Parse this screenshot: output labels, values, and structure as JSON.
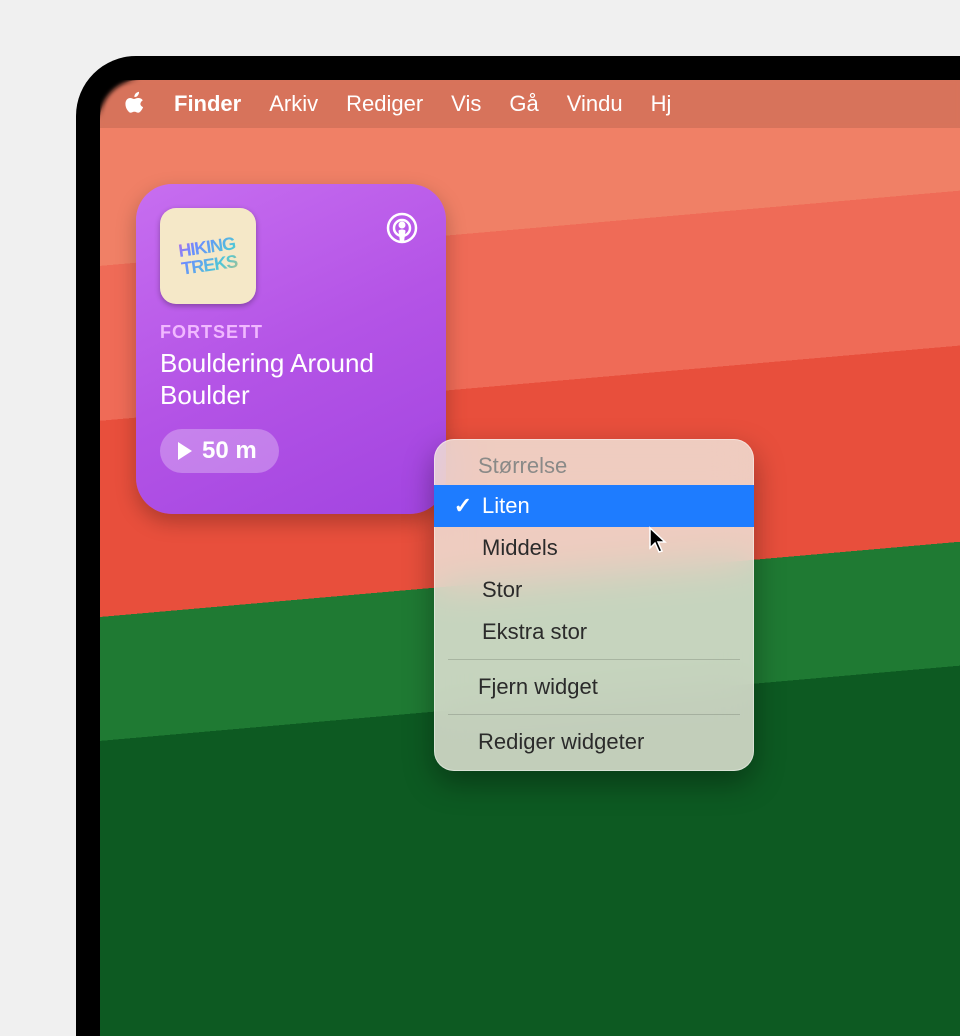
{
  "menubar": {
    "app_name": "Finder",
    "items": [
      "Arkiv",
      "Rediger",
      "Vis",
      "Gå",
      "Vindu",
      "Hj"
    ]
  },
  "widget": {
    "artwork_label": "HIKING TREKS",
    "subtitle": "FORTSETT",
    "title": "Bouldering Around Boulder",
    "duration": "50 m"
  },
  "context_menu": {
    "header": "Størrelse",
    "sizes": [
      {
        "label": "Liten",
        "checked": true
      },
      {
        "label": "Middels",
        "checked": false
      },
      {
        "label": "Stor",
        "checked": false
      },
      {
        "label": "Ekstra stor",
        "checked": false
      }
    ],
    "remove": "Fjern widget",
    "edit": "Rediger widgeter"
  }
}
